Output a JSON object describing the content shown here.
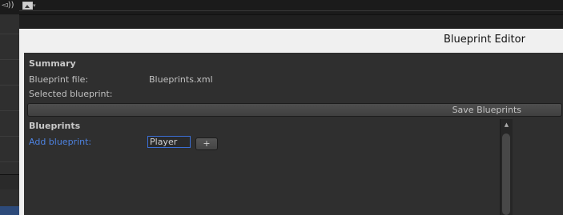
{
  "window": {
    "title": "Blueprint Editor"
  },
  "toolbar": {
    "audio_icon": "audio-icon",
    "image_icon": "image-icon",
    "dropdown_icon": "chevron-down-icon",
    "audio_glyph": "◅))",
    "dropdown_glyph": "▾"
  },
  "summary": {
    "heading": "Summary",
    "blueprint_file_label": "Blueprint file:",
    "blueprint_file_value": "Blueprints.xml",
    "selected_blueprint_label": "Selected blueprint:",
    "selected_blueprint_value": ""
  },
  "actions": {
    "save_label": "Save Blueprints"
  },
  "blueprints": {
    "heading": "Blueprints",
    "add_label": "Add blueprint:",
    "name_input_value": "Player",
    "add_button_label": "+"
  },
  "scrollbar": {
    "up_glyph": "▲"
  },
  "colors": {
    "accent": "#4d82e0",
    "input_border": "#3b6fd6",
    "panel_bg": "#2f2f2f",
    "titlebar_bg": "#f0f0f0"
  }
}
